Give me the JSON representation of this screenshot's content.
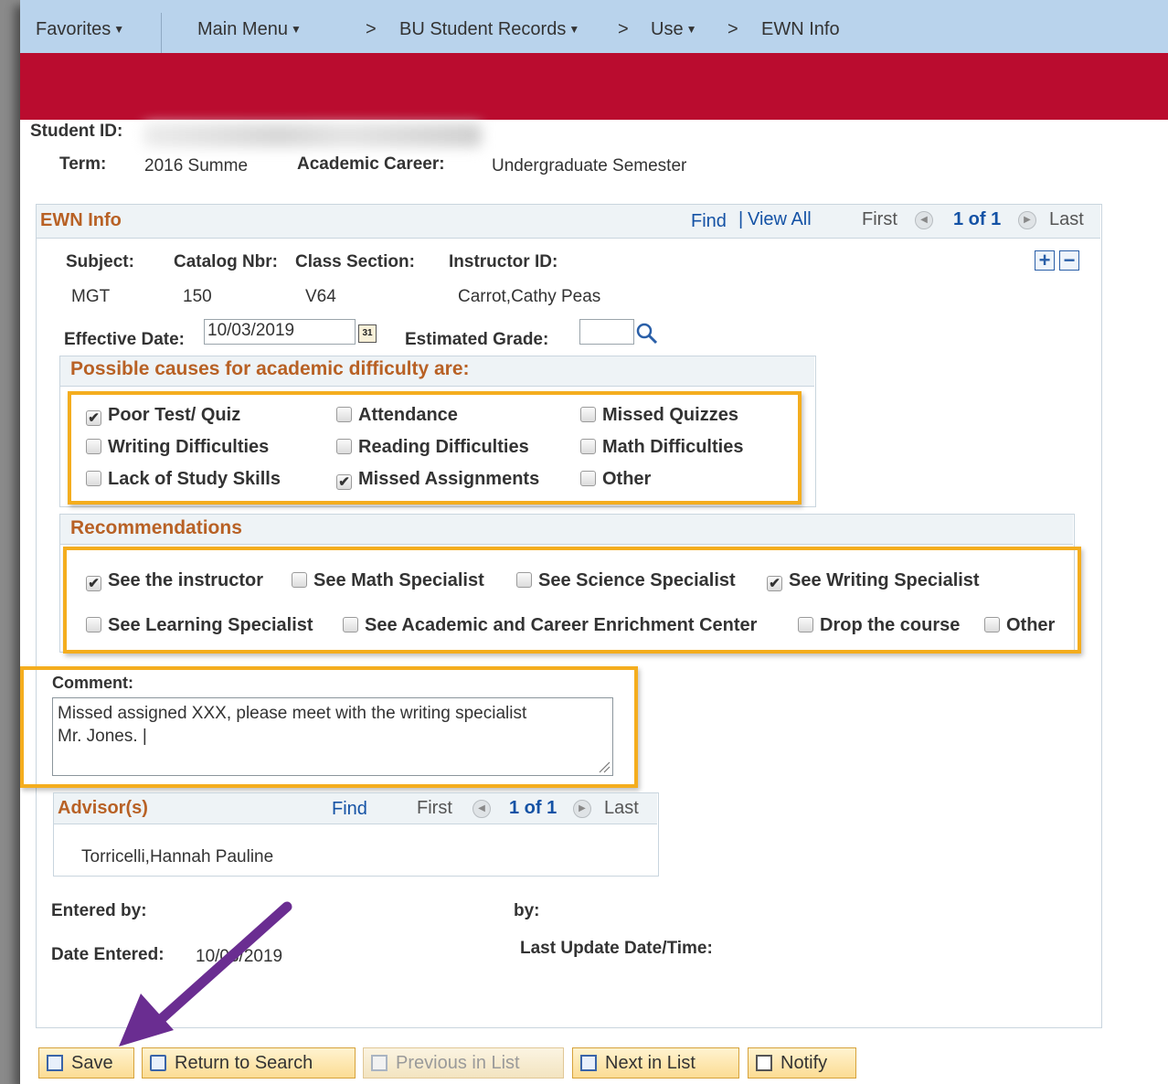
{
  "nav": {
    "favorites": "Favorites",
    "main_menu": "Main Menu",
    "sep": ">",
    "bu_student_records": "BU Student Records",
    "use": "Use",
    "ewn_info": "EWN Info"
  },
  "header": {
    "student_id_label": "Student ID:",
    "term_label": "Term:",
    "term_value": "2016 Summe",
    "career_label": "Academic Career:",
    "career_value": "Undergraduate Semester"
  },
  "ewn": {
    "title": "EWN Info",
    "find": "Find",
    "divider": "|",
    "view_all": "View All",
    "first": "First",
    "count": "1 of 1",
    "last": "Last",
    "add": "+",
    "remove": "−",
    "subject_label": "Subject:",
    "catalog_label": "Catalog Nbr:",
    "section_label": "Class Section:",
    "instructor_label": "Instructor ID:",
    "subject_value": "MGT",
    "catalog_value": "150",
    "section_value": "V64",
    "instructor_value": "Carrot,Cathy Peas",
    "effective_date_label": "Effective Date:",
    "effective_date_value": "10/03/2019",
    "calendar_icon_text": "31",
    "estimated_grade_label": "Estimated Grade:",
    "estimated_grade_value": ""
  },
  "causes": {
    "title": "Possible causes for academic difficulty are:",
    "items": [
      {
        "label": "Poor Test/ Quiz",
        "checked": true
      },
      {
        "label": "Attendance",
        "checked": false
      },
      {
        "label": "Missed Quizzes",
        "checked": false
      },
      {
        "label": "Writing Difficulties",
        "checked": false
      },
      {
        "label": "Reading Difficulties",
        "checked": false
      },
      {
        "label": "Math Difficulties",
        "checked": false
      },
      {
        "label": "Lack of Study Skills",
        "checked": false
      },
      {
        "label": "Missed Assignments",
        "checked": true
      },
      {
        "label": "Other",
        "checked": false
      }
    ]
  },
  "recommendations": {
    "title": "Recommendations",
    "items": [
      {
        "label": "See the instructor",
        "checked": true
      },
      {
        "label": "See Math Specialist",
        "checked": false
      },
      {
        "label": "See Science Specialist",
        "checked": false
      },
      {
        "label": "See Writing Specialist",
        "checked": true
      },
      {
        "label": "See Learning Specialist",
        "checked": false
      },
      {
        "label": "See Academic and Career Enrichment Center",
        "checked": false
      },
      {
        "label": "Drop the course",
        "checked": false
      },
      {
        "label": "Other",
        "checked": false
      }
    ]
  },
  "comment": {
    "label": "Comment:",
    "value": "Missed assigned XXX, please meet with the writing specialist\nMr. Jones. |"
  },
  "advisors": {
    "title": "Advisor(s)",
    "find": "Find",
    "first": "First",
    "count": "1 of 1",
    "last": "Last",
    "name": "Torricelli,Hannah Pauline"
  },
  "footer_info": {
    "entered_by_label": "Entered by:",
    "by_label": "by:",
    "date_entered_label": "Date Entered:",
    "date_entered_value": "10/03/2019",
    "last_update_label": "Last Update Date/Time:"
  },
  "toolbar": {
    "save": "Save",
    "return_to_search": "Return to Search",
    "previous_in_list": "Previous in List",
    "next_in_list": "Next in List",
    "notify": "Notify"
  },
  "colors": {
    "brand_red": "#ba0c2f",
    "nav_blue": "#b9d3ec",
    "highlight_orange": "#f4ad1e",
    "arrow_purple": "#6a2d91",
    "section_title": "#b86125",
    "link_blue": "#1452a5"
  }
}
